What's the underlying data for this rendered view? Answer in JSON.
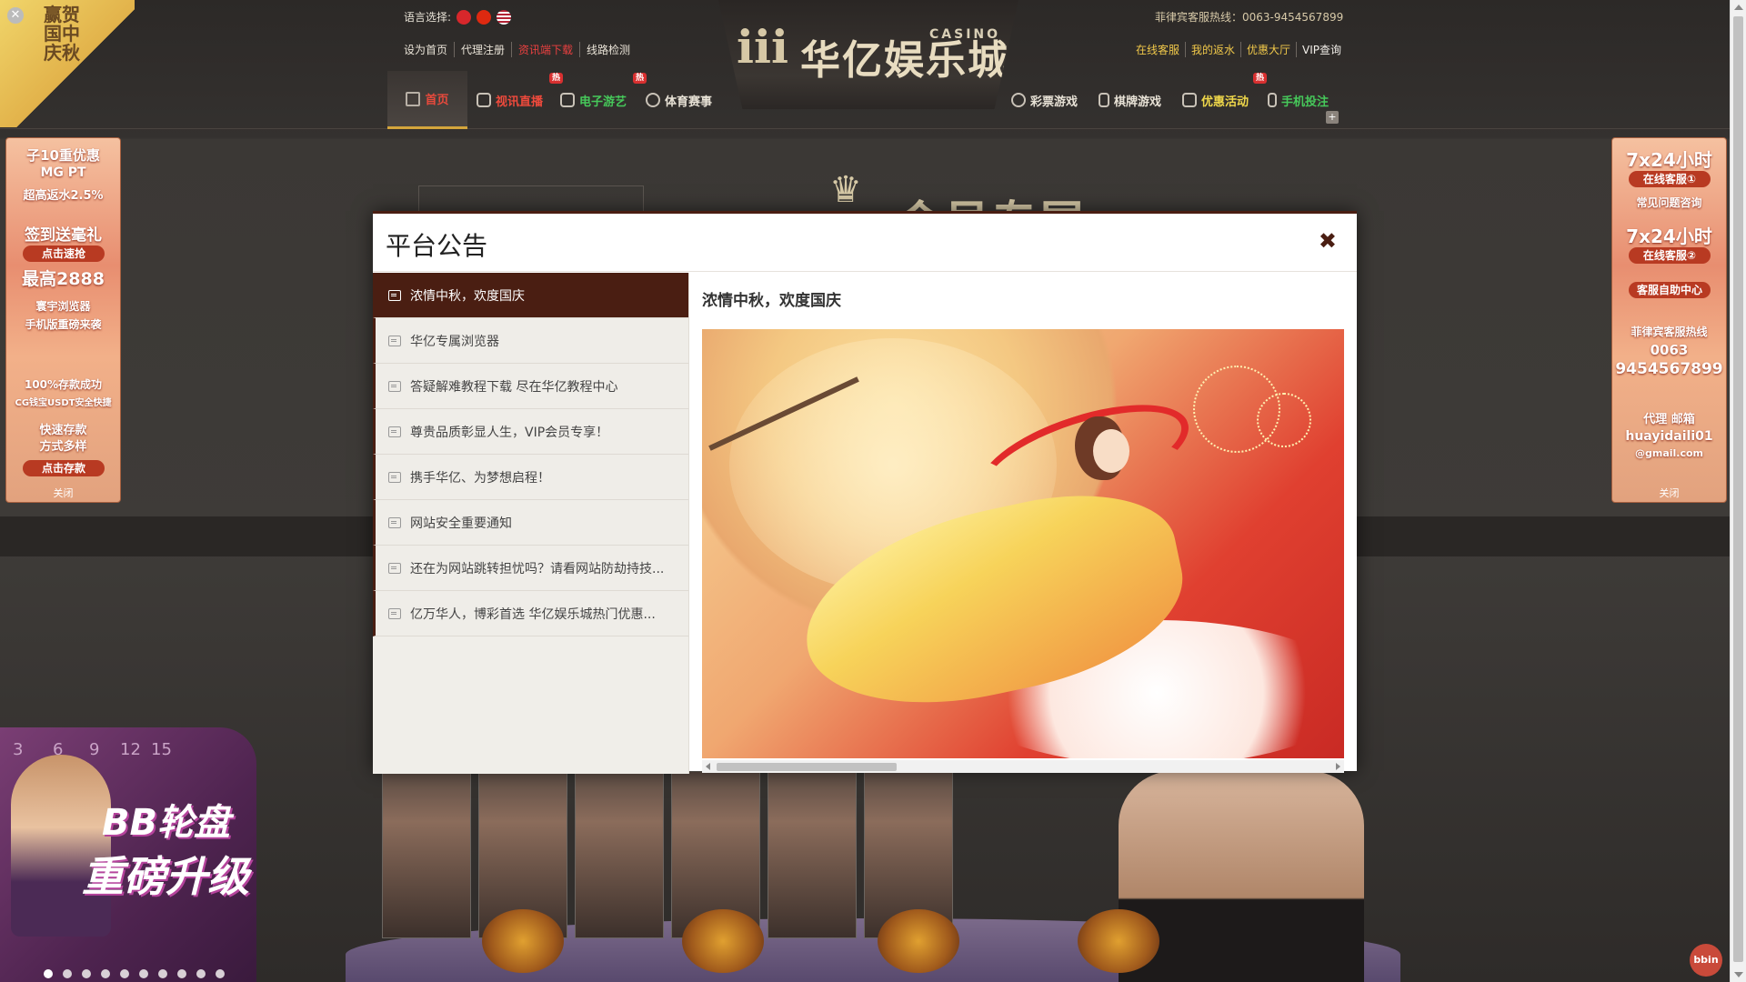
{
  "header": {
    "language_label": "语言选择:",
    "languages": [
      "hk-flag-icon",
      "cn-flag-icon",
      "us-flag-icon"
    ],
    "quick_links": [
      "设为首页",
      "代理注册",
      "资讯端下载",
      "线路检测"
    ],
    "hotline": "菲律宾客服热线：0063-9454567899",
    "user_links": [
      "在线客服",
      "我的返水",
      "优惠大厅",
      "VIP查询"
    ],
    "logo": {
      "mark": "ⅲ",
      "text": "华亿娱乐城",
      "casino": "CASINO"
    }
  },
  "nav": {
    "items": [
      {
        "label": "首页",
        "icon": "home-icon",
        "color": "red"
      },
      {
        "label": "视讯直播",
        "icon": "live-icon",
        "color": "red",
        "badge": "热"
      },
      {
        "label": "电子游艺",
        "icon": "gamepad-icon",
        "color": "green",
        "badge": "热"
      },
      {
        "label": "体育赛事",
        "icon": "soccer-icon",
        "color": "white"
      },
      {
        "label": "彩票游戏",
        "icon": "lottery-icon",
        "color": "white"
      },
      {
        "label": "棋牌游戏",
        "icon": "cards-icon",
        "color": "white"
      },
      {
        "label": "优惠活动",
        "icon": "gift-icon",
        "color": "yellow",
        "badge": "热"
      },
      {
        "label": "手机投注",
        "icon": "mobile-icon",
        "color": "green"
      }
    ],
    "plus": "+"
  },
  "background": {
    "crown": "♛",
    "title": "会员专属",
    "stripe_color": "#2a2725"
  },
  "corner_badge": {
    "text": "赢贺国中庆秋",
    "close": "✕"
  },
  "left_ad": {
    "lines": [
      "子10重优惠",
      "MG PT",
      "超高返水2.5%",
      "签到送毫礼",
      "点击速抢",
      "最高2888",
      "寰宇浏览器",
      "手机版重磅来袭",
      "100%存款成功",
      "CG钱宝USDT安全快捷",
      "快速存款",
      "方式多样",
      "点击存款"
    ],
    "close": "关闭"
  },
  "right_ad": {
    "lines": [
      "7x24小时",
      "在线客服①",
      "常见问题咨询",
      "7x24小时",
      "在线客服②",
      "客服自助中心",
      "菲律宾客服热线",
      "0063",
      "9454567899",
      "代理 邮箱",
      "huayidaili01",
      "@gmail.com"
    ],
    "close": "关闭"
  },
  "bottom_promo": {
    "numbers": [
      "3",
      "6",
      "9",
      "12",
      "15"
    ],
    "title_line1": "BB轮盘",
    "title_line2": "重磅升级",
    "dots": 10,
    "active_dot": 0
  },
  "brand_badge": "bbin",
  "modal": {
    "title": "平台公告",
    "close_label": "✖",
    "notices": [
      "浓情中秋，欢度国庆",
      "华亿专属浏览器",
      "答疑解难教程下载 尽在华亿教程中心",
      "尊贵品质彰显人生，VIP会员专享！",
      "携手华亿、为梦想启程！",
      "网站安全重要通知",
      "还在为网站跳转担忧吗？请看网站防劫持技...",
      "亿万华人，博彩首选 华亿娱乐城热门优惠..."
    ],
    "active_index": 0,
    "detail_title": "浓情中秋，欢度国庆"
  },
  "colors": {
    "accent": "#4a1e12",
    "nav_red": "#ef4a3c",
    "nav_green": "#46c85a",
    "nav_yellow": "#f0d84a",
    "gold": "#f0c84a"
  }
}
